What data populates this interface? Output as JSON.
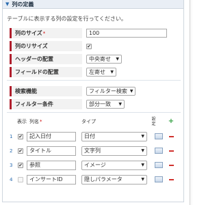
{
  "section": {
    "title": "列の定義",
    "description": "テーブルに表示する列の設定を行ってください。"
  },
  "props": {
    "col_size": {
      "label": "列のサイズ",
      "required": "*",
      "value": "100"
    },
    "col_resize": {
      "label": "列のリサイズ",
      "checked_glyph": "✔"
    },
    "header_align": {
      "label": "ヘッダーの配置",
      "value": "中央寄せ"
    },
    "field_align": {
      "label": "フィールドの配置",
      "value": "左寄せ"
    },
    "search": {
      "label": "検索機能",
      "value": "フィルター検索"
    },
    "filter": {
      "label": "フィルター条件",
      "value": "部分一致"
    }
  },
  "table": {
    "headers": {
      "show": "表示",
      "name": "列名",
      "name_required": "*",
      "type": "タイプ",
      "setting": "設定"
    },
    "rows": [
      {
        "num": "1",
        "checked": "✔",
        "name": "記入日付",
        "type": "日付"
      },
      {
        "num": "2",
        "checked": "✔",
        "name": "タイトル",
        "type": "文字列"
      },
      {
        "num": "3",
        "checked": "✔",
        "name": "参照",
        "type": "イメージ"
      },
      {
        "num": "4",
        "checked": "",
        "name": "インサートID",
        "type": "隠しパラメータ"
      }
    ]
  },
  "colors": {
    "accent_bar": "#b01e2c",
    "add": "#2e9e3e",
    "remove": "#d0312d",
    "header_bg": "#e9eef5"
  }
}
